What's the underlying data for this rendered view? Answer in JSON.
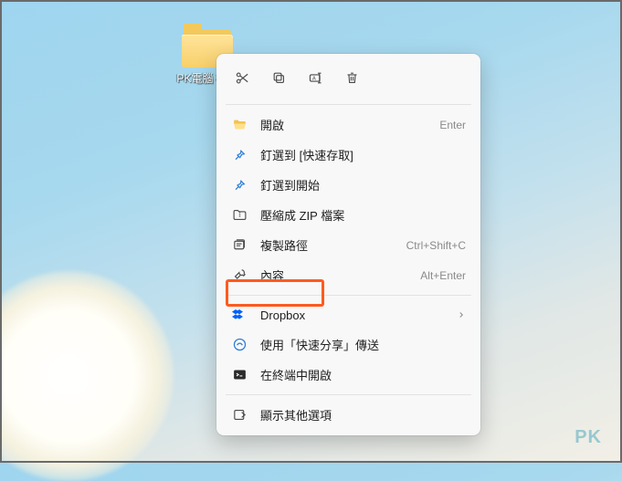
{
  "desktop": {
    "folder_label": "PK電腦\n檔案"
  },
  "toolbar": {
    "cut": "cut",
    "copy": "copy",
    "rename": "rename",
    "delete": "delete"
  },
  "menu": {
    "open": {
      "label": "開啟",
      "shortcut": "Enter"
    },
    "pin_quick": {
      "label": "釘選到 [快速存取]"
    },
    "pin_start": {
      "label": "釘選到開始"
    },
    "compress_zip": {
      "label": "壓縮成 ZIP 檔案"
    },
    "copy_path": {
      "label": "複製路徑",
      "shortcut": "Ctrl+Shift+C"
    },
    "properties": {
      "label": "內容",
      "shortcut": "Alt+Enter"
    },
    "dropbox": {
      "label": "Dropbox"
    },
    "quick_share": {
      "label": "使用「快速分享」傳送"
    },
    "open_terminal": {
      "label": "在終端中開啟"
    },
    "show_more": {
      "label": "顯示其他選項"
    }
  },
  "watermark": "PK"
}
